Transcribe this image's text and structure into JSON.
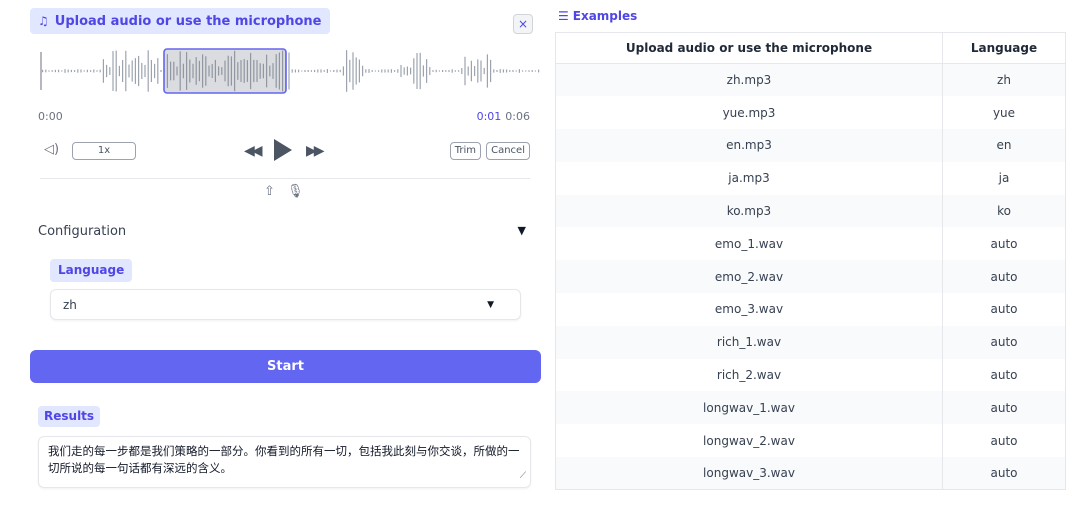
{
  "audio": {
    "label": "Upload audio or use the microphone",
    "close": "×",
    "time_start": "0:00",
    "time_current": "0:01",
    "time_total": "0:06",
    "speed": "1x",
    "trim": "Trim",
    "cancel": "Cancel"
  },
  "config": {
    "title": "Configuration",
    "language_label": "Language",
    "language_value": "zh"
  },
  "start_button": "Start",
  "results": {
    "label": "Results",
    "text": "我们走的每一步都是我们策略的一部分。你看到的所有一切，包括我此刻与你交谈，所做的一切所说的每一句话都有深远的含义。"
  },
  "examples": {
    "title": "Examples",
    "headers": [
      "Upload audio or use the microphone",
      "Language"
    ],
    "rows": [
      [
        "zh.mp3",
        "zh"
      ],
      [
        "yue.mp3",
        "yue"
      ],
      [
        "en.mp3",
        "en"
      ],
      [
        "ja.mp3",
        "ja"
      ],
      [
        "ko.mp3",
        "ko"
      ],
      [
        "emo_1.wav",
        "auto"
      ],
      [
        "emo_2.wav",
        "auto"
      ],
      [
        "emo_3.wav",
        "auto"
      ],
      [
        "rich_1.wav",
        "auto"
      ],
      [
        "rich_2.wav",
        "auto"
      ],
      [
        "longwav_1.wav",
        "auto"
      ],
      [
        "longwav_2.wav",
        "auto"
      ],
      [
        "longwav_3.wav",
        "auto"
      ]
    ]
  },
  "colors": {
    "accent": "#6366f1",
    "badge_bg": "#e0e7ff",
    "badge_text": "#4f46e5"
  },
  "icons": [
    "music-note-icon",
    "close-icon",
    "volume-icon",
    "rewind-icon",
    "play-icon",
    "forward-icon",
    "upload-icon",
    "microphone-icon",
    "triangle-down-icon",
    "caret-down-icon",
    "resize-icon",
    "list-icon"
  ]
}
